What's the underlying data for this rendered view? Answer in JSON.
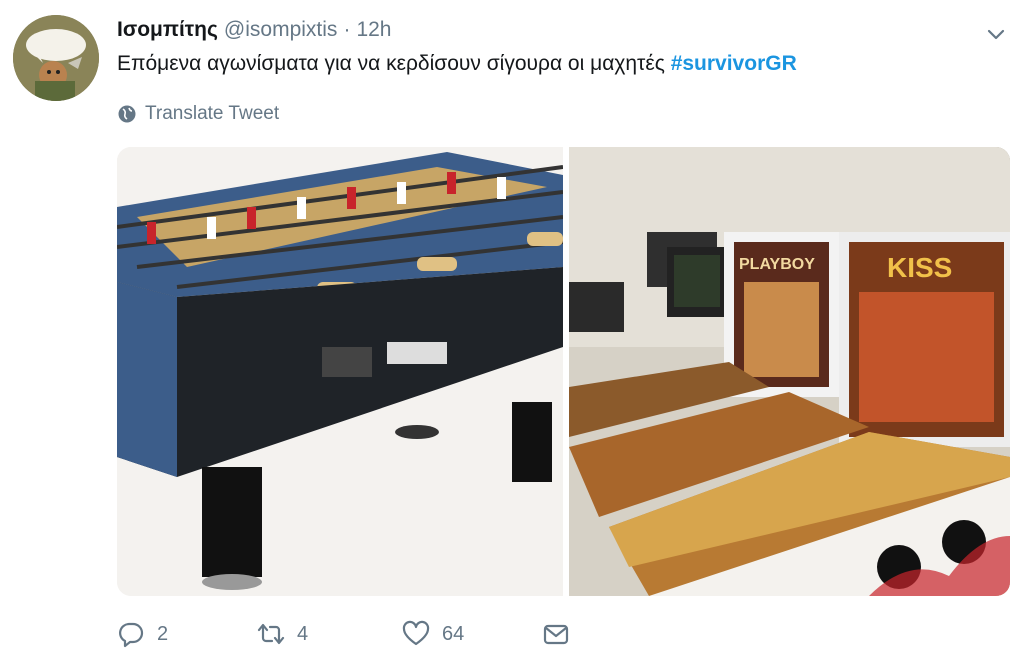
{
  "tweet": {
    "display_name": "Ισομπίτης",
    "handle": "@isompixtis",
    "separator": "·",
    "time": "12h",
    "text": "Επόμενα αγωνίσματα για να κερδίσουν σίγουρα οι μαχητές",
    "hashtag": "#survivorGR",
    "translate_label": "Translate Tweet"
  },
  "media": {
    "left_image": "foosball-table",
    "right_image": "pinball-machines",
    "pinball_titles": [
      "PLAYBOY",
      "KISS"
    ]
  },
  "actions": {
    "reply_count": "2",
    "retweet_count": "4",
    "like_count": "64"
  },
  "icons": {
    "chevron": "chevron-down-icon",
    "globe": "globe-icon",
    "reply": "reply-icon",
    "retweet": "retweet-icon",
    "like": "heart-icon",
    "dm": "envelope-icon"
  },
  "colors": {
    "hashtag": "#1b95e0",
    "muted": "#657786",
    "text": "#14171a"
  }
}
